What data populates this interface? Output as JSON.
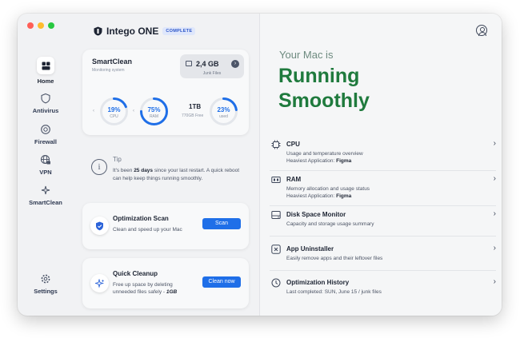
{
  "app": {
    "name": "Intego ONE",
    "badge": "COMPLETE"
  },
  "sidebar": {
    "items": [
      {
        "label": "Home",
        "icon": "home-icon"
      },
      {
        "label": "Antivirus",
        "icon": "shield-icon"
      },
      {
        "label": "Firewall",
        "icon": "firewall-icon"
      },
      {
        "label": "VPN",
        "icon": "vpn-globe-icon"
      },
      {
        "label": "SmartClean",
        "icon": "smartclean-icon"
      }
    ],
    "settings_label": "Settings"
  },
  "smartclean": {
    "title": "SmartClean",
    "subtitle": "Monitoring system",
    "junk_value": "2,4 GB",
    "junk_label": "Junk Files",
    "cpu": {
      "value": "19%",
      "label": "CPU",
      "percent": 19
    },
    "ram": {
      "value": "75%",
      "label": "RAM",
      "percent": 75
    },
    "disk": {
      "total": "1TB",
      "free": "770GB Free"
    },
    "used": {
      "value": "23%",
      "label": "used",
      "percent": 23
    }
  },
  "tip": {
    "title": "Tip",
    "text_before": "It's been ",
    "days": "25 days",
    "text_after": " since your last restart. A quick reboot can help keep things running smoothly."
  },
  "optimization_scan": {
    "title": "Optimization Scan",
    "desc": "Clean and speed up your Mac",
    "button": "Scan"
  },
  "quick_cleanup": {
    "title": "Quick Cleanup",
    "desc_line1": "Free up space by deleting",
    "desc_line2": "unneeded files safely - ",
    "desc_size": "1GB",
    "button": "Clean now"
  },
  "status": {
    "heading": "Your Mac is",
    "state": "Running Smoothly",
    "color": "#1f7a3d"
  },
  "details": [
    {
      "title": "CPU",
      "desc": "Usage and temperature overview",
      "heavy_label": "Heaviest Application: ",
      "heavy_app": "Figma",
      "icon": "cpu-icon"
    },
    {
      "title": "RAM",
      "desc": "Memory allocation and usage status",
      "heavy_label": "Heaviest Application: ",
      "heavy_app": "Figma",
      "icon": "ram-icon"
    },
    {
      "title": "Disk Space Monitor",
      "desc": "Capacity and storage usage summary",
      "icon": "disk-icon"
    },
    {
      "title": "App Uninstaller",
      "desc": "Easily remove apps and their leftover files",
      "icon": "uninstaller-icon"
    },
    {
      "title": "Optimization History",
      "desc": "Last completed: SUN, June 15 / junk files",
      "icon": "history-icon"
    }
  ],
  "colors": {
    "accent": "#1f6fe8",
    "good": "#1f7a3d"
  }
}
